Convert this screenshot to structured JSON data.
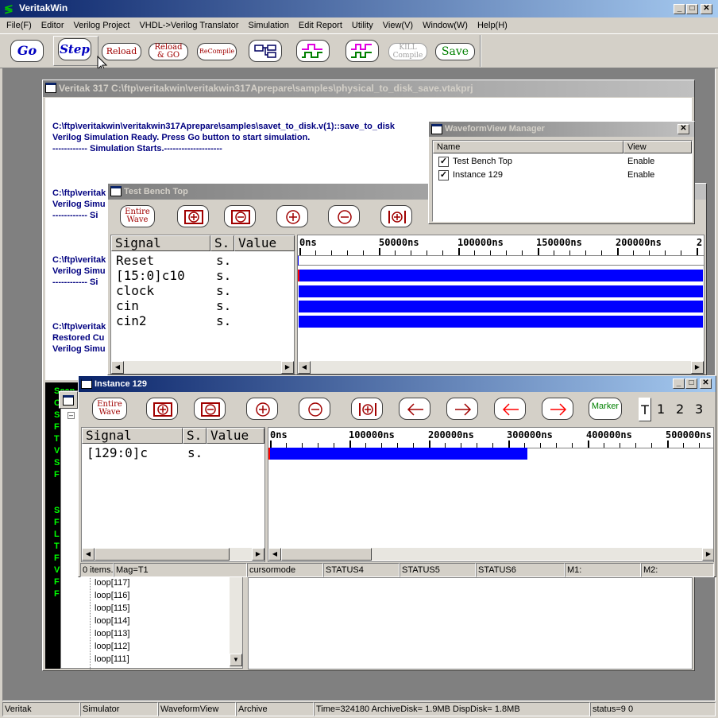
{
  "app": {
    "title": "VeritakWin"
  },
  "menu": [
    "File(F)",
    "Editor",
    "Verilog Project",
    "VHDL->Verilog Translator",
    "Simulation",
    "Edit Report",
    "Utility",
    "View(V)",
    "Window(W)",
    "Help(H)"
  ],
  "toolbar": {
    "go": "Go",
    "step": "Step",
    "reload": "Reload",
    "reload_go_1": "Reload",
    "reload_go_2": "& GO",
    "recompile": "ReCompile",
    "kill_1": "KILL",
    "kill_2": "Compile",
    "save": "Save"
  },
  "project_window": {
    "title": "Veritak 317 C:\\ftp\\veritakwin\\veritakwin317Aprepare\\samples\\physical_to_disk_save.vtakprj",
    "log": [
      "C:\\ftp\\veritakwin\\veritakwin317Aprepare\\samples\\savet_to_disk.v(1)::save_to_disk",
      "Verilog Simulation Ready. Press Go button to start simulation.",
      "------------ Simulation Starts.--------------------"
    ],
    "log_partial": [
      "C:\\ftp\\veritak",
      "Verilog Simu",
      "------------ Si",
      "C:\\ftp\\veritak",
      "Verilog Simu",
      "------------ Si",
      "C:\\ftp\\veritak",
      "Restored Cu",
      "Verilog Simu"
    ],
    "console_letters": [
      "Scan",
      "C",
      "S",
      "F",
      "T",
      "V",
      "S",
      "F",
      "",
      "",
      "S",
      "F",
      "L",
      "T",
      "F",
      "V",
      "F",
      "F"
    ],
    "tree_items": [
      "loop[117]",
      "loop[116]",
      "loop[115]",
      "loop[114]",
      "loop[113]",
      "loop[112]",
      "loop[111]"
    ]
  },
  "tbt": {
    "title": "Test Bench Top",
    "entire_1": "Entire",
    "entire_2": "Wave",
    "headers": {
      "signal": "Signal",
      "s": "S.",
      "value": "Value"
    },
    "signals": [
      {
        "name": "Reset",
        "s": "s."
      },
      {
        "name": "[15:0]c10",
        "s": "s."
      },
      {
        "name": "clock",
        "s": "s."
      },
      {
        "name": "cin",
        "s": "s."
      },
      {
        "name": "cin2",
        "s": "s."
      }
    ],
    "ticks": [
      "0ns",
      "50000ns",
      "100000ns",
      "150000ns",
      "200000ns",
      "2"
    ]
  },
  "wvm": {
    "title": "WaveformView Manager",
    "col_name": "Name",
    "col_view": "View",
    "items": [
      {
        "name": "Test Bench Top",
        "view": "Enable"
      },
      {
        "name": "Instance 129",
        "view": "Enable"
      }
    ]
  },
  "inst": {
    "title": "Instance 129",
    "entire_1": "Entire",
    "entire_2": "Wave",
    "marker": "Marker",
    "tabs": [
      "T",
      "1",
      "2",
      "3"
    ],
    "headers": {
      "signal": "Signal",
      "s": "S.",
      "value": "Value"
    },
    "signals": [
      {
        "name": "[129:0]c",
        "s": "s."
      }
    ],
    "ticks": [
      "0ns",
      "100000ns",
      "200000ns",
      "300000ns",
      "400000ns",
      "500000ns"
    ],
    "status": [
      "0 items.",
      "Mag=T1",
      "cursormode",
      "STATUS4",
      "STATUS5",
      "STATUS6",
      "M1:",
      "M2:"
    ]
  },
  "statusbar": [
    "Veritak",
    "Simulator",
    "WaveformView",
    "Archive",
    "Time=324180 ArchiveDisk= 1.9MB DispDisk= 1.8MB",
    "status=9 0"
  ],
  "colors": {
    "title_active": "#0a246a",
    "wave": "#0000ff",
    "console": "#000000",
    "console_text": "#00ff00"
  }
}
